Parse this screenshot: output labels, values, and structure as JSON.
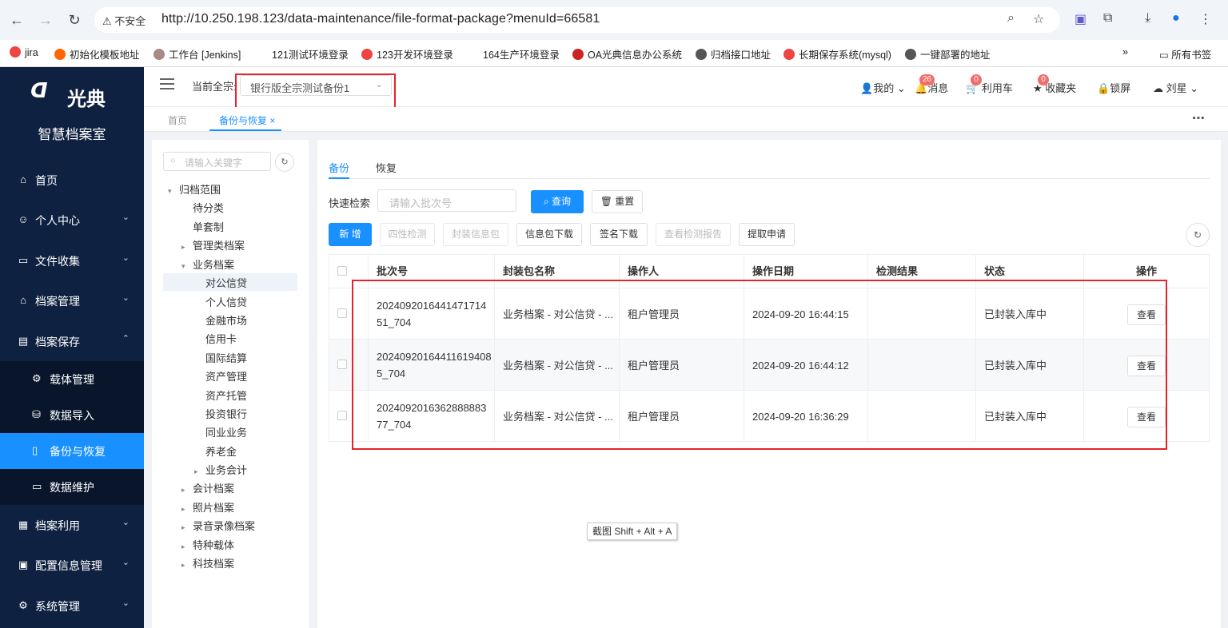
{
  "browser": {
    "insecure_label": "不安全",
    "url": "http://10.250.198.123/data-maintenance/file-format-package?menuId=66581",
    "bookmarks": [
      "jira",
      "初始化模板地址",
      "工作台 [Jenkins]",
      "121测试环境登录",
      "123开发环境登录",
      "164生产环境登录",
      "OA光典信息办公系统",
      "归档接口地址",
      "长期保存系统(mysql)",
      "一键部署的地址"
    ],
    "bookmarks_more": "»",
    "all_bookmarks": "所有书签"
  },
  "sidebar": {
    "logo_text": "光典",
    "logo_sub": "智慧档案室",
    "items": [
      {
        "label": "首页",
        "icon": "home-icon"
      },
      {
        "label": "个人中心",
        "icon": "user-icon"
      },
      {
        "label": "文件收集",
        "icon": "folder-icon"
      },
      {
        "label": "档案管理",
        "icon": "bank-icon"
      },
      {
        "label": "档案保存",
        "icon": "archive-icon"
      },
      {
        "label": "档案利用",
        "icon": "calendar-icon"
      },
      {
        "label": "配置信息管理",
        "icon": "clipboard-icon"
      },
      {
        "label": "系统管理",
        "icon": "gear-icon"
      }
    ],
    "sub_items": [
      {
        "label": "载体管理"
      },
      {
        "label": "数据导入"
      },
      {
        "label": "备份与恢复"
      },
      {
        "label": "数据维护"
      }
    ]
  },
  "header": {
    "current_label": "当前全宗:",
    "current_value": "银行版全宗测试备份1",
    "mine": "我的",
    "messages": "消息",
    "messages_count": "26",
    "cart": "利用车",
    "cart_count": "0",
    "favorites": "收藏夹",
    "favorites_count": "0",
    "lock": "锁屏",
    "user": "刘星"
  },
  "tabs": {
    "home": "首页",
    "active": "备份与恢复",
    "close": "×"
  },
  "tree": {
    "search_placeholder": "请输入关键字",
    "nodes": [
      "归档范围",
      "待分类",
      "单套制",
      "管理类档案",
      "业务档案",
      "对公信贷",
      "个人信贷",
      "金融市场",
      "信用卡",
      "国际结算",
      "资产管理",
      "资产托管",
      "投资银行",
      "同业业务",
      "养老金",
      "业务会计",
      "会计档案",
      "照片档案",
      "录音录像档案",
      "特种载体",
      "科技档案"
    ]
  },
  "main": {
    "subtabs": [
      "备份",
      "恢复"
    ],
    "quick_search_label": "快速检索",
    "batch_placeholder": "请输入批次号",
    "query_btn": "查询",
    "reset_btn": "重置",
    "toolbar": [
      "新 增",
      "四性检测",
      "封装信息包",
      "信息包下载",
      "签名下载",
      "查看检测报告",
      "提取申请"
    ],
    "columns": [
      "批次号",
      "封装包名称",
      "操作人",
      "操作日期",
      "检测结果",
      "状态",
      "操作"
    ],
    "rows": [
      {
        "batch_line1": "2024092016441471714",
        "batch_line2": "51_704",
        "name": "业务档案 - 对公信贷 - ...",
        "operator": "租户管理员",
        "date": "2024-09-20 16:44:15",
        "result": "",
        "status": "已封装入库中",
        "action": "查看"
      },
      {
        "batch_line1": "2024092016441161940​8",
        "batch_line2": "5_704",
        "name": "业务档案 - 对公信贷 - ...",
        "operator": "租户管理员",
        "date": "2024-09-20 16:44:12",
        "result": "",
        "status": "已封装入库中",
        "action": "查看"
      },
      {
        "batch_line1": "2024092016362888883",
        "batch_line2": "77_704",
        "name": "业务档案 - 对公信贷 - ...",
        "operator": "租户管理员",
        "date": "2024-09-20 16:36:29",
        "result": "",
        "status": "已封装入库中",
        "action": "查看"
      }
    ]
  },
  "tooltip": "截图 Shift + Alt + A"
}
